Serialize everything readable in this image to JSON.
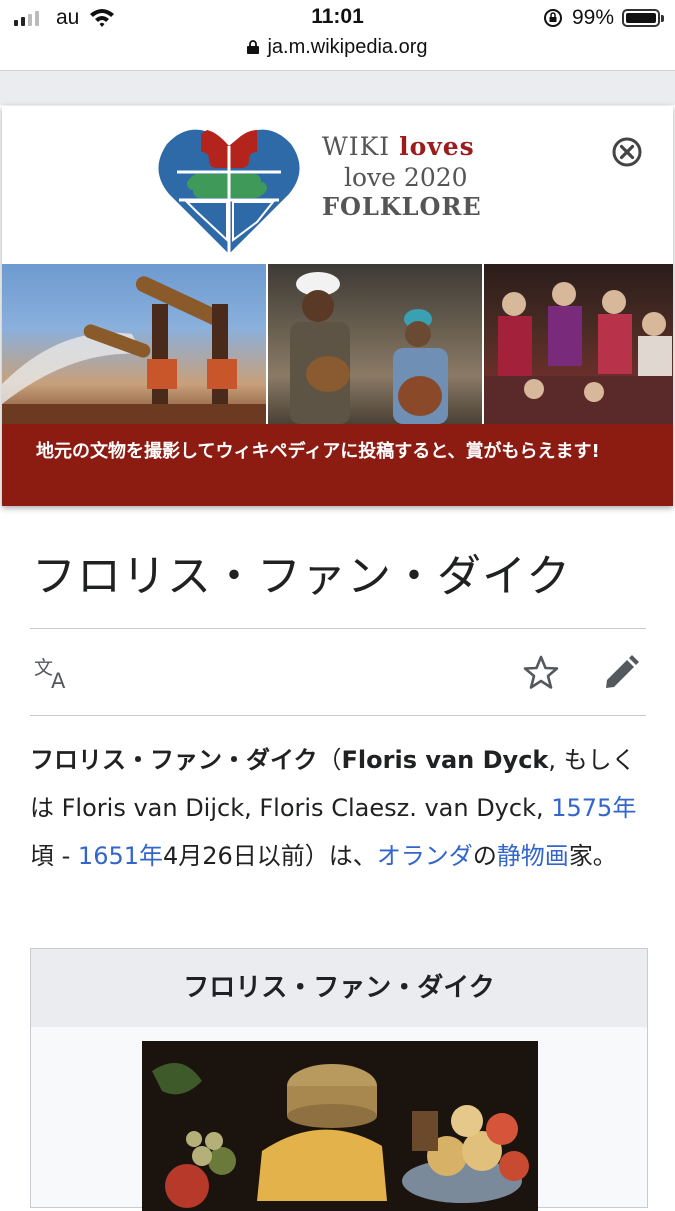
{
  "status_bar": {
    "carrier": "au",
    "time": "11:01",
    "battery": "99%"
  },
  "url": "ja.m.wikipedia.org",
  "banner": {
    "brand_line1_a": "WIKI ",
    "brand_line1_b": "loves",
    "brand_line2": "love 2020",
    "brand_line3": "FOLKLORE",
    "notice": "地元の文物を撮影してウィキペディアに投稿すると、賞がもらえます!",
    "colors": {
      "notice_bg": "#8c1b12",
      "puzzle_blue": "#2f6aa8",
      "puzzle_red": "#b3241c",
      "puzzle_green": "#3f9a5a"
    }
  },
  "article": {
    "title": "フロリス・ファン・ダイク",
    "lead": {
      "name_bold": "フロリス・ファン・ダイク",
      "paren_open": "（",
      "latin_bold": "Floris van Dyck",
      "alt": ", もしくは Floris van Dijck, Floris Claesz. van Dyck, ",
      "link_1575": "1575年",
      "mid1": "頃 - ",
      "link_1651": "1651年",
      "mid2": "4月26日以前）は、",
      "link_country": "オランダ",
      "mid3": "の",
      "link_genre": "静物画",
      "end": "家。"
    },
    "infobox_title": "フロリス・ファン・ダイク"
  },
  "icons": [
    "signal-icon",
    "wifi-icon",
    "rotation-lock-icon",
    "battery-icon",
    "padlock-icon",
    "wiki-loves-folklore-logo",
    "close-icon",
    "language-icon",
    "star-icon",
    "edit-pencil-icon"
  ]
}
